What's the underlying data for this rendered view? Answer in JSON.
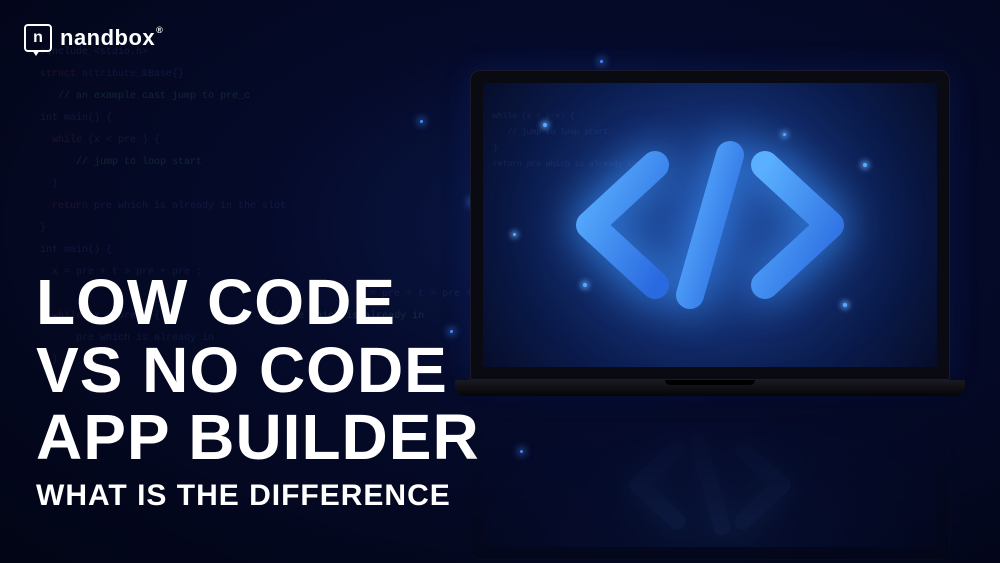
{
  "logo": {
    "mark_letter": "n",
    "brand_name": "nandbox",
    "registered_symbol": "®"
  },
  "headline": {
    "line1": "LOW CODE",
    "line2": "VS NO CODE",
    "line3": "APP BUILDER",
    "subtitle": "WHAT IS THE DIFFERENCE"
  },
  "laptop": {
    "icon_name": "code-brackets-icon"
  }
}
